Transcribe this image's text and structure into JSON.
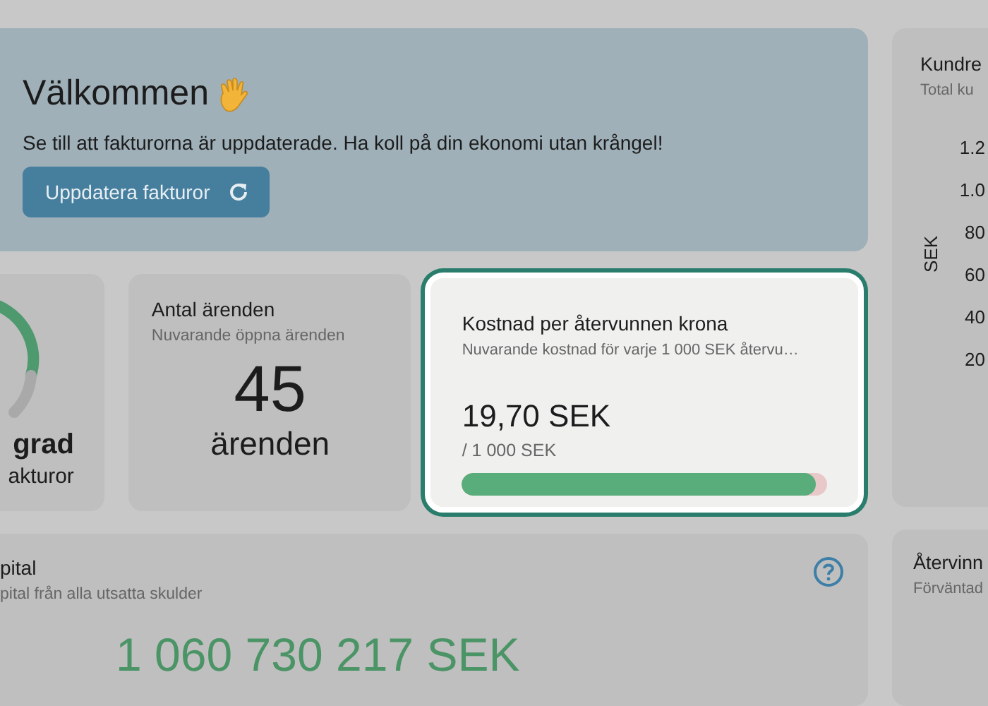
{
  "welcome": {
    "title": "Välkommen",
    "text": "Se till att fakturorna är uppdaterade. Ha koll på din ekonomi utan krångel!",
    "button": "Uppdatera fakturor"
  },
  "gauge_card": {
    "title": "grad",
    "subtitle": "akturor"
  },
  "cases_card": {
    "title": "Antal ärenden",
    "subtitle": "Nuvarande öppna ärenden",
    "value": "45",
    "unit": "ärenden"
  },
  "cost_card": {
    "title": "Kostnad per återvunnen krona",
    "subtitle": "Nuvarande kostnad för varje 1 000 SEK återvu…",
    "value": "19,70 SEK",
    "unit": "/ 1 000 SEK",
    "level": 0.97,
    "highlighted": true
  },
  "customer_card": {
    "title": "Kundre",
    "subtitle": "Total ku",
    "axis_label": "SEK",
    "ticks": [
      "1.2",
      "1.0",
      "80",
      "60",
      "40",
      "20"
    ]
  },
  "capital_card": {
    "title": "pital",
    "subtitle": "pital från alla utsatta skulder",
    "value": "1 060 730 217 SEK"
  },
  "recovery_card": {
    "title": "Återvinn",
    "subtitle": "Förväntad"
  }
}
